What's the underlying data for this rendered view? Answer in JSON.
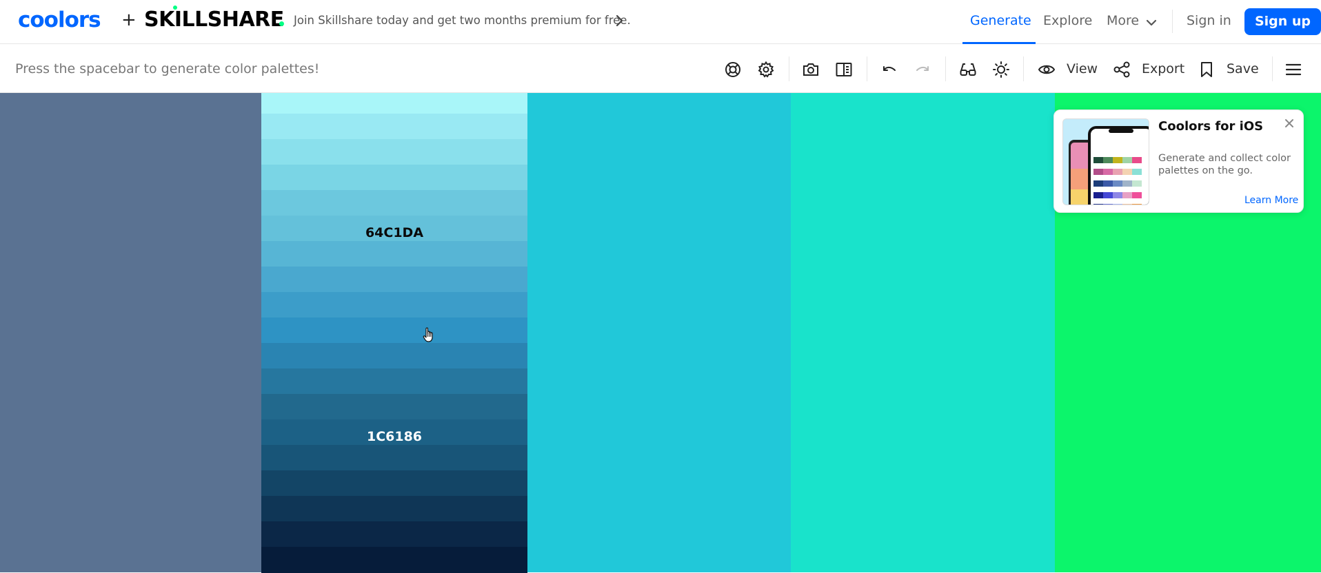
{
  "nav": {
    "logo_left": "coolors",
    "plus": "+",
    "logo_right": "SKILLSHARE",
    "promo_text": "Join Skillshare today and get two months premium for free.",
    "links": {
      "generate": "Generate",
      "explore": "Explore",
      "more": "More",
      "sign_in": "Sign in"
    },
    "signup_label": "Sign up",
    "accent_color": "#0066ff"
  },
  "toolbar": {
    "hint": "Press the spacebar to generate color palettes!",
    "icons": [
      "help-icon",
      "settings-icon",
      "camera-icon",
      "book-icon",
      "undo-icon",
      "redo-icon",
      "glasses-icon",
      "sun-icon",
      "eye-icon",
      "share-icon",
      "bookmark-icon",
      "menu-icon"
    ],
    "view_label": "View",
    "export_label": "Export",
    "save_label": "Save"
  },
  "palette": {
    "columns": [
      {
        "color": "#5a7292"
      },
      {
        "color": "#64c1da",
        "shades_view": true
      },
      {
        "color": "#21c8d9"
      },
      {
        "color": "#19e3cb"
      },
      {
        "color": "#0cf56b"
      }
    ],
    "shades": [
      "#a9f6f9",
      "#99e9f3",
      "#8ae0ec",
      "#7ad5e5",
      "#6cc8de",
      "#64c1da",
      "#57b5d5",
      "#4aa8cf",
      "#3c9dc9",
      "#2e93c4",
      "#2a84b2",
      "#26779f",
      "#22698d",
      "#1c6186",
      "#185578",
      "#134566",
      "#0f3656",
      "#0b2747",
      "#061c3a"
    ],
    "shade_labels": {
      "hovered": "64C1DA",
      "selected": "1C6186"
    }
  },
  "ios_card": {
    "title": "Coolors for iOS",
    "description": "Generate and collect color palettes on the go.",
    "link": "Learn More"
  }
}
